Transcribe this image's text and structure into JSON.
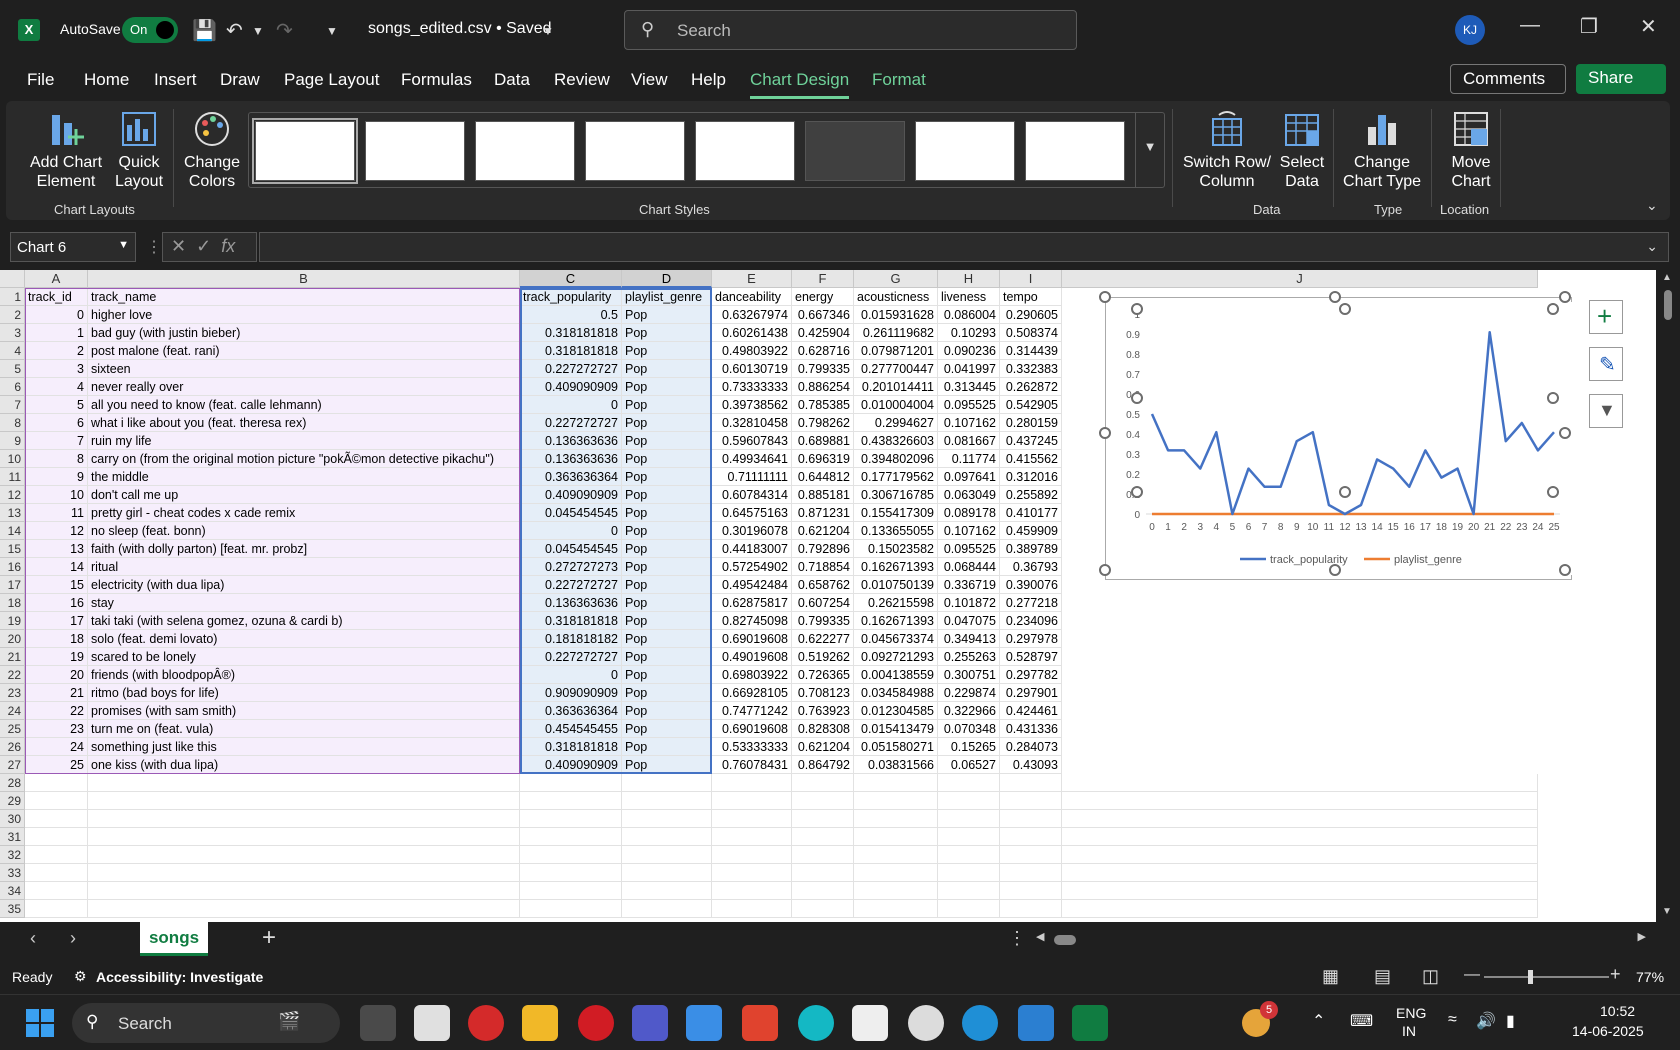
{
  "titlebar": {
    "app_logo": "X",
    "autosave_label": "AutoSave",
    "autosave_state": "On",
    "filename": "songs_edited.csv • Saved",
    "search_placeholder": "Search",
    "avatar_initials": "KJ"
  },
  "menu": {
    "items": [
      "File",
      "Home",
      "Insert",
      "Draw",
      "Page Layout",
      "Formulas",
      "Data",
      "Review",
      "View",
      "Help",
      "Chart Design",
      "Format"
    ],
    "active": "Chart Design",
    "comments": "Comments",
    "share": "Share"
  },
  "ribbon": {
    "add_chart_element": [
      "Add Chart",
      "Element"
    ],
    "quick_layout": [
      "Quick",
      "Layout"
    ],
    "change_colors": [
      "Change",
      "Colors"
    ],
    "switch_row_column": [
      "Switch Row/",
      "Column"
    ],
    "select_data": [
      "Select",
      "Data"
    ],
    "change_chart_type": [
      "Change",
      "Chart Type"
    ],
    "move_chart": [
      "Move",
      "Chart"
    ],
    "groups": {
      "chart_layouts": "Chart Layouts",
      "chart_styles": "Chart Styles",
      "data": "Data",
      "type": "Type",
      "location": "Location"
    },
    "style_count": 8
  },
  "formula_bar": {
    "name_box": "Chart 6",
    "fx": "fx",
    "value": ""
  },
  "sheet": {
    "columns": [
      "A",
      "B",
      "C",
      "D",
      "E",
      "F",
      "G",
      "H",
      "I",
      "J"
    ],
    "headers": [
      "track_id",
      "track_name",
      "track_popularity",
      "playlist_genre",
      "danceability",
      "energy",
      "acousticness",
      "liveness",
      "tempo"
    ],
    "rows": [
      [
        "0",
        "higher love",
        "0.5",
        "Pop",
        "0.63267974",
        "0.667346",
        "0.015931628",
        "0.086004",
        "0.290605"
      ],
      [
        "1",
        "bad guy (with justin bieber)",
        "0.318181818",
        "Pop",
        "0.60261438",
        "0.425904",
        "0.261119682",
        "0.10293",
        "0.508374"
      ],
      [
        "2",
        "post malone (feat. rani)",
        "0.318181818",
        "Pop",
        "0.49803922",
        "0.628716",
        "0.079871201",
        "0.090236",
        "0.314439"
      ],
      [
        "3",
        "sixteen",
        "0.227272727",
        "Pop",
        "0.60130719",
        "0.799335",
        "0.277700447",
        "0.041997",
        "0.332383"
      ],
      [
        "4",
        "never really over",
        "0.409090909",
        "Pop",
        "0.73333333",
        "0.886254",
        "0.201014411",
        "0.313445",
        "0.262872"
      ],
      [
        "5",
        "all you need to know (feat. calle lehmann)",
        "0",
        "Pop",
        "0.39738562",
        "0.785385",
        "0.010004004",
        "0.095525",
        "0.542905"
      ],
      [
        "6",
        "what i like about you (feat. theresa rex)",
        "0.227272727",
        "Pop",
        "0.32810458",
        "0.798262",
        "0.2994627",
        "0.107162",
        "0.280159"
      ],
      [
        "7",
        "ruin my life",
        "0.136363636",
        "Pop",
        "0.59607843",
        "0.689881",
        "0.438326603",
        "0.081667",
        "0.437245"
      ],
      [
        "8",
        "carry on (from the original motion picture \"pokÃ©mon detective pikachu\")",
        "0.136363636",
        "Pop",
        "0.49934641",
        "0.696319",
        "0.394802096",
        "0.11774",
        "0.415562"
      ],
      [
        "9",
        "the middle",
        "0.363636364",
        "Pop",
        "0.71111111",
        "0.644812",
        "0.177179562",
        "0.097641",
        "0.312016"
      ],
      [
        "10",
        "don't call me up",
        "0.409090909",
        "Pop",
        "0.60784314",
        "0.885181",
        "0.306716785",
        "0.063049",
        "0.255892"
      ],
      [
        "11",
        "pretty girl - cheat codes x cade remix",
        "0.045454545",
        "Pop",
        "0.64575163",
        "0.871231",
        "0.155417309",
        "0.089178",
        "0.410177"
      ],
      [
        "12",
        "no sleep (feat. bonn)",
        "0",
        "Pop",
        "0.30196078",
        "0.621204",
        "0.133655055",
        "0.107162",
        "0.459909"
      ],
      [
        "13",
        "faith (with dolly parton) [feat. mr. probz]",
        "0.045454545",
        "Pop",
        "0.44183007",
        "0.792896",
        "0.15023582",
        "0.095525",
        "0.389789"
      ],
      [
        "14",
        "ritual",
        "0.272727273",
        "Pop",
        "0.57254902",
        "0.718854",
        "0.162671393",
        "0.068444",
        "0.36793"
      ],
      [
        "15",
        "electricity (with dua lipa)",
        "0.227272727",
        "Pop",
        "0.49542484",
        "0.658762",
        "0.010750139",
        "0.336719",
        "0.390076"
      ],
      [
        "16",
        "stay",
        "0.136363636",
        "Pop",
        "0.62875817",
        "0.607254",
        "0.26215598",
        "0.101872",
        "0.277218"
      ],
      [
        "17",
        "taki taki (with selena gomez, ozuna & cardi b)",
        "0.318181818",
        "Pop",
        "0.82745098",
        "0.799335",
        "0.162671393",
        "0.047075",
        "0.234096"
      ],
      [
        "18",
        "solo (feat. demi lovato)",
        "0.181818182",
        "Pop",
        "0.69019608",
        "0.622277",
        "0.045673374",
        "0.349413",
        "0.297978"
      ],
      [
        "19",
        "scared to be lonely",
        "0.227272727",
        "Pop",
        "0.49019608",
        "0.519262",
        "0.092721293",
        "0.255263",
        "0.528797"
      ],
      [
        "20",
        "friends (with bloodpopÂ®)",
        "0",
        "Pop",
        "0.69803922",
        "0.726365",
        "0.004138559",
        "0.300751",
        "0.297782"
      ],
      [
        "21",
        "ritmo (bad boys for life)",
        "0.909090909",
        "Pop",
        "0.66928105",
        "0.708123",
        "0.034584988",
        "0.229874",
        "0.297901"
      ],
      [
        "22",
        "promises (with sam smith)",
        "0.363636364",
        "Pop",
        "0.74771242",
        "0.763923",
        "0.012304585",
        "0.322966",
        "0.424461"
      ],
      [
        "23",
        "turn me on (feat. vula)",
        "0.454545455",
        "Pop",
        "0.69019608",
        "0.828308",
        "0.015413479",
        "0.070348",
        "0.431336"
      ],
      [
        "24",
        "something just like this",
        "0.318181818",
        "Pop",
        "0.53333333",
        "0.621204",
        "0.051580271",
        "0.15265",
        "0.284073"
      ],
      [
        "25",
        "one kiss (with dua lipa)",
        "0.409090909",
        "Pop",
        "0.76078431",
        "0.864792",
        "0.03831566",
        "0.06527",
        "0.43093"
      ]
    ],
    "row_numbers": [
      "1",
      "2",
      "3",
      "4",
      "5",
      "6",
      "7",
      "8",
      "9",
      "10",
      "11",
      "12",
      "13",
      "14",
      "15",
      "16",
      "17",
      "18",
      "19",
      "20",
      "21",
      "22",
      "23",
      "24",
      "25",
      "26",
      "27",
      "28",
      "29",
      "30",
      "31",
      "32",
      "33",
      "34",
      "35"
    ]
  },
  "chart_data": {
    "type": "line",
    "title": "",
    "xlabel": "",
    "ylabel": "",
    "x": [
      0,
      1,
      2,
      3,
      4,
      5,
      6,
      7,
      8,
      9,
      10,
      11,
      12,
      13,
      14,
      15,
      16,
      17,
      18,
      19,
      20,
      21,
      22,
      23,
      24,
      25
    ],
    "ylim": [
      0,
      1
    ],
    "yticks": [
      "0",
      "0.1",
      "0.2",
      "0.3",
      "0.4",
      "0.5",
      "0.6",
      "0.7",
      "0.8",
      "0.9",
      "1"
    ],
    "series": [
      {
        "name": "track_popularity",
        "color": "#4472c4",
        "values": [
          0.5,
          0.318,
          0.318,
          0.227,
          0.409,
          0,
          0.227,
          0.136,
          0.136,
          0.364,
          0.409,
          0.045,
          0,
          0.045,
          0.273,
          0.227,
          0.136,
          0.318,
          0.182,
          0.227,
          0,
          0.909,
          0.364,
          0.455,
          0.318,
          0.409
        ]
      },
      {
        "name": "playlist_genre",
        "color": "#ed7d31",
        "values": [
          0,
          0,
          0,
          0,
          0,
          0,
          0,
          0,
          0,
          0,
          0,
          0,
          0,
          0,
          0,
          0,
          0,
          0,
          0,
          0,
          0,
          0,
          0,
          0,
          0,
          0
        ]
      }
    ],
    "legend": "bottom",
    "grid": false
  },
  "sheet_tab": "songs",
  "status": {
    "ready": "Ready",
    "accessibility": "Accessibility: Investigate",
    "zoom": "77%"
  },
  "taskbar": {
    "search": "Search",
    "lang_top": "ENG",
    "lang_bottom": "IN",
    "time": "10:52",
    "date": "14-06-2025",
    "badge": "5"
  },
  "colors": {
    "accent": "#107c41",
    "chart_design": "#6fd29a",
    "series1": "#4472c4",
    "series2": "#ed7d31"
  }
}
